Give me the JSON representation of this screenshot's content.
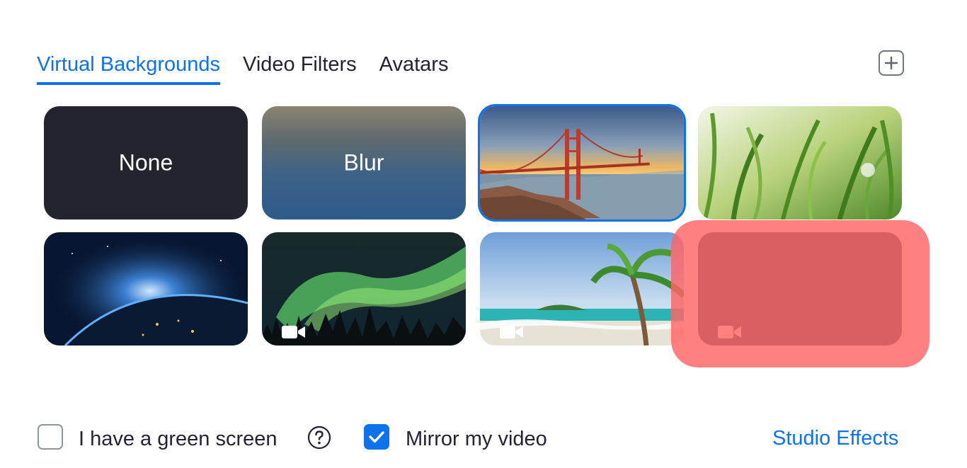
{
  "tabs": [
    {
      "label": "Virtual Backgrounds",
      "active": true
    },
    {
      "label": "Video Filters",
      "active": false
    },
    {
      "label": "Avatars",
      "active": false
    }
  ],
  "add_button": {
    "icon": "plus-icon"
  },
  "backgrounds": [
    {
      "label": "None",
      "kind": "none"
    },
    {
      "label": "Blur",
      "kind": "blur"
    },
    {
      "label": "",
      "kind": "golden-gate-bridge",
      "selected": true
    },
    {
      "label": "",
      "kind": "grass"
    },
    {
      "label": "",
      "kind": "earth-from-space"
    },
    {
      "label": "",
      "kind": "aurora",
      "video": true
    },
    {
      "label": "",
      "kind": "beach-palm",
      "video": true
    },
    {
      "label": "",
      "kind": "redacted",
      "video": true
    }
  ],
  "footer": {
    "green_screen_label": "I have a green screen",
    "green_screen_checked": false,
    "mirror_label": "Mirror my video",
    "mirror_checked": true,
    "studio_effects_label": "Studio Effects"
  },
  "colors": {
    "accent": "#0e72ed",
    "text": "#232333",
    "redaction": "#ff6464"
  }
}
